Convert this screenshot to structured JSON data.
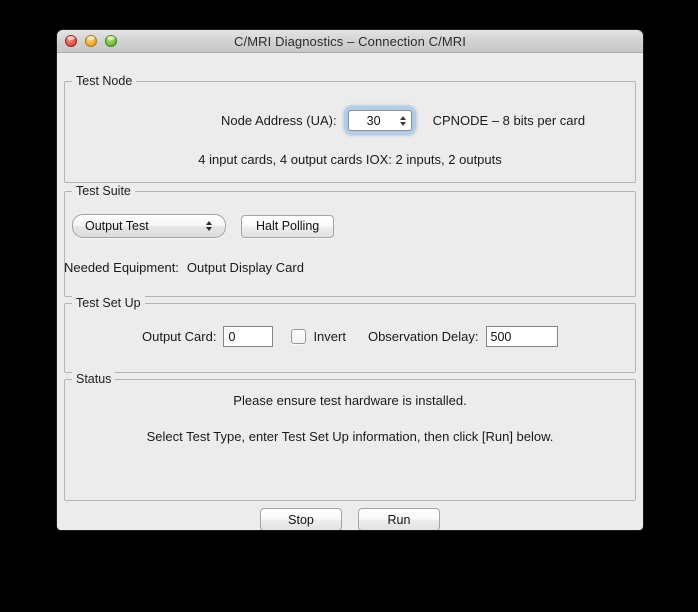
{
  "window": {
    "title": "C/MRI Diagnostics – Connection C/MRI",
    "controls": {
      "close": "close",
      "minimize": "minimize",
      "maximize": "maximize"
    }
  },
  "test_node": {
    "group_title": "Test Node",
    "node_address_label": "Node Address (UA):",
    "node_address_value": "30",
    "node_type_info": "CPNODE – 8 bits per card",
    "card_summary": "4 input cards, 4 output cards  IOX: 2 inputs, 2 outputs"
  },
  "test_suite": {
    "group_title": "Test Suite",
    "selected_test": "Output Test",
    "halt_polling_label": "Halt Polling",
    "needed_equipment_label": "Needed Equipment:",
    "needed_equipment_value": "Output Display Card"
  },
  "test_setup": {
    "group_title": "Test Set Up",
    "output_card_label": "Output Card:",
    "output_card_value": "0",
    "invert_label": "Invert",
    "invert_checked": false,
    "observation_delay_label": "Observation Delay:",
    "observation_delay_value": "500"
  },
  "status": {
    "group_title": "Status",
    "line1": "Please ensure test hardware is installed.",
    "line2": "Select Test Type, enter Test Set Up information, then click [Run] below."
  },
  "actions": {
    "stop_label": "Stop",
    "run_label": "Run"
  },
  "colors": {
    "window_background": "#ececec",
    "desktop_background": "#000000",
    "focus_ring": "#5da0de",
    "close_button": "#e05c52",
    "minimize_button": "#f0b03c",
    "maximize_button": "#7cc24a"
  }
}
